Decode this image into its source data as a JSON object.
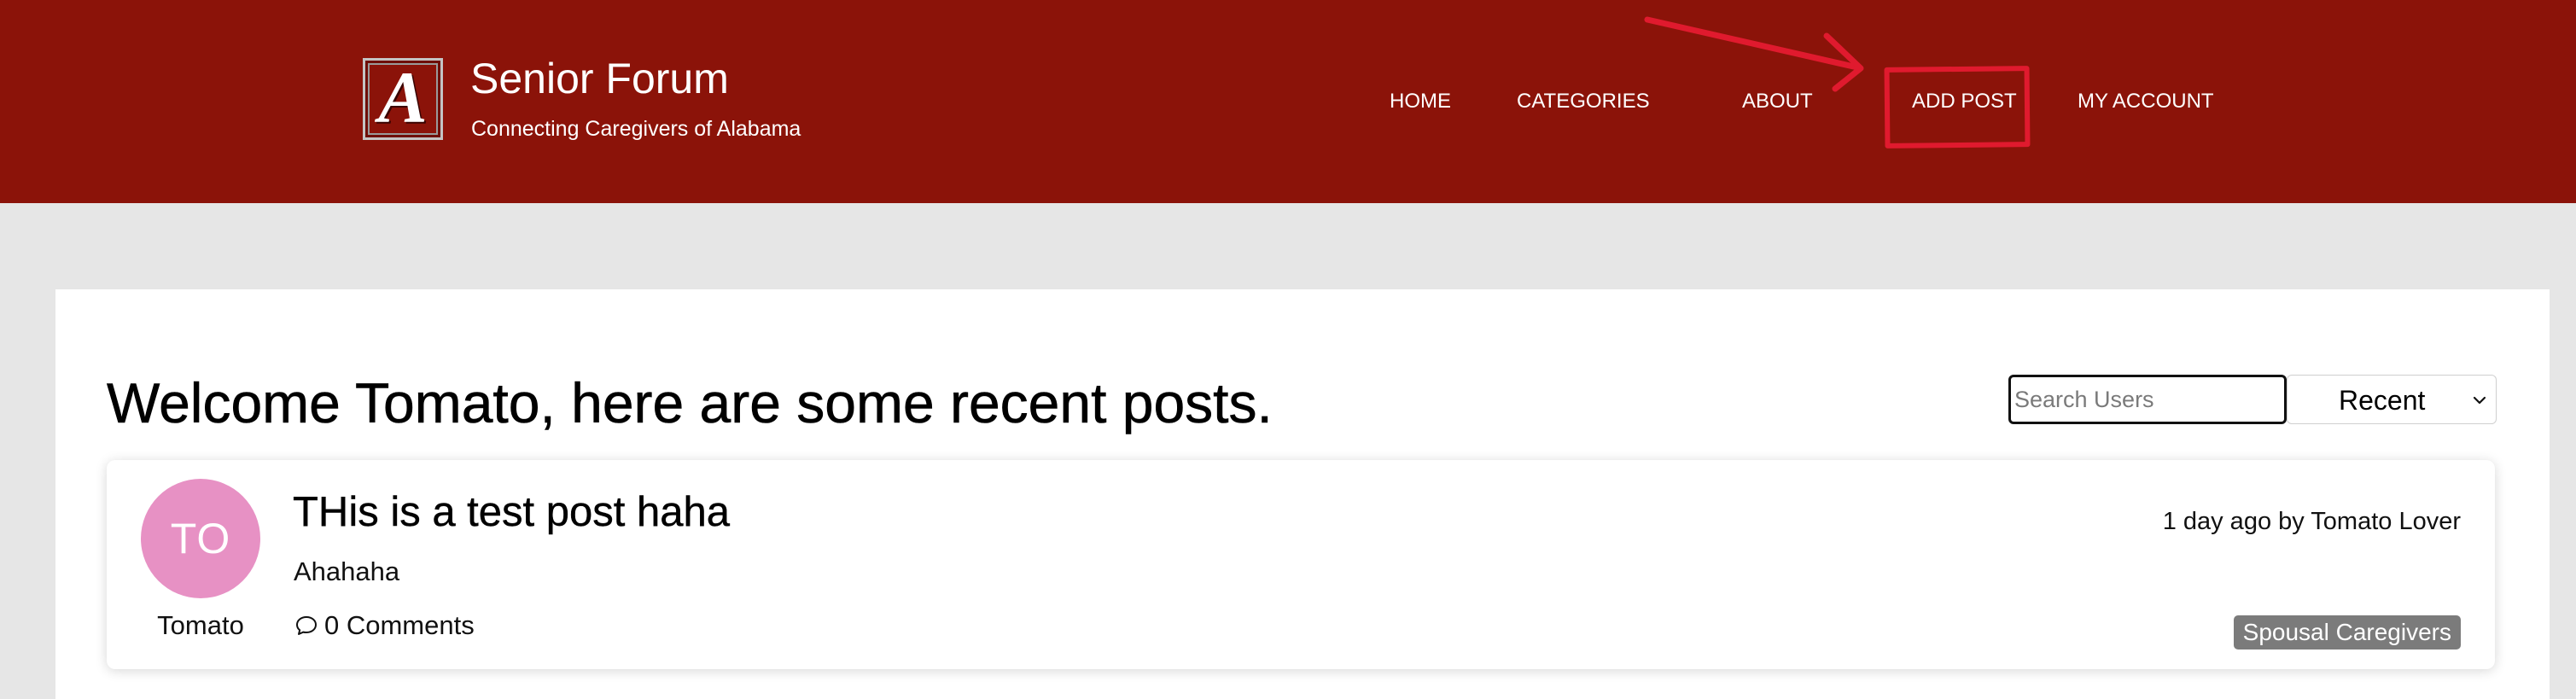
{
  "colors": {
    "header_background": "#8b1309",
    "page_background": "#e6e6e6",
    "annotation_red": "#e01a2e",
    "avatar_background": "#e791c4",
    "badge_background": "#7b7b7b"
  },
  "header": {
    "logo_letter": "A",
    "site_title": "Senior Forum",
    "tagline": "Connecting Caregivers of Alabama",
    "nav": {
      "home": "HOME",
      "categories": "CATEGORIES",
      "about": "ABOUT",
      "add_post": "ADD POST",
      "my_account": "MY ACCOUNT"
    }
  },
  "main": {
    "welcome_heading": "Welcome Tomato, here are some recent posts.",
    "search": {
      "placeholder": "Search Users",
      "value": ""
    },
    "sort": {
      "selected": "Recent",
      "icon": "chevron-down-icon"
    },
    "posts": [
      {
        "avatar_initials": "TO",
        "author_name": "Tomato",
        "title": "THis is a test post haha",
        "body": "Ahahaha",
        "comments_label": "0 Comments",
        "comment_icon": "speech-bubble-icon",
        "meta": "1 day ago by Tomato Lover",
        "category": "Spousal Caregivers"
      }
    ]
  }
}
